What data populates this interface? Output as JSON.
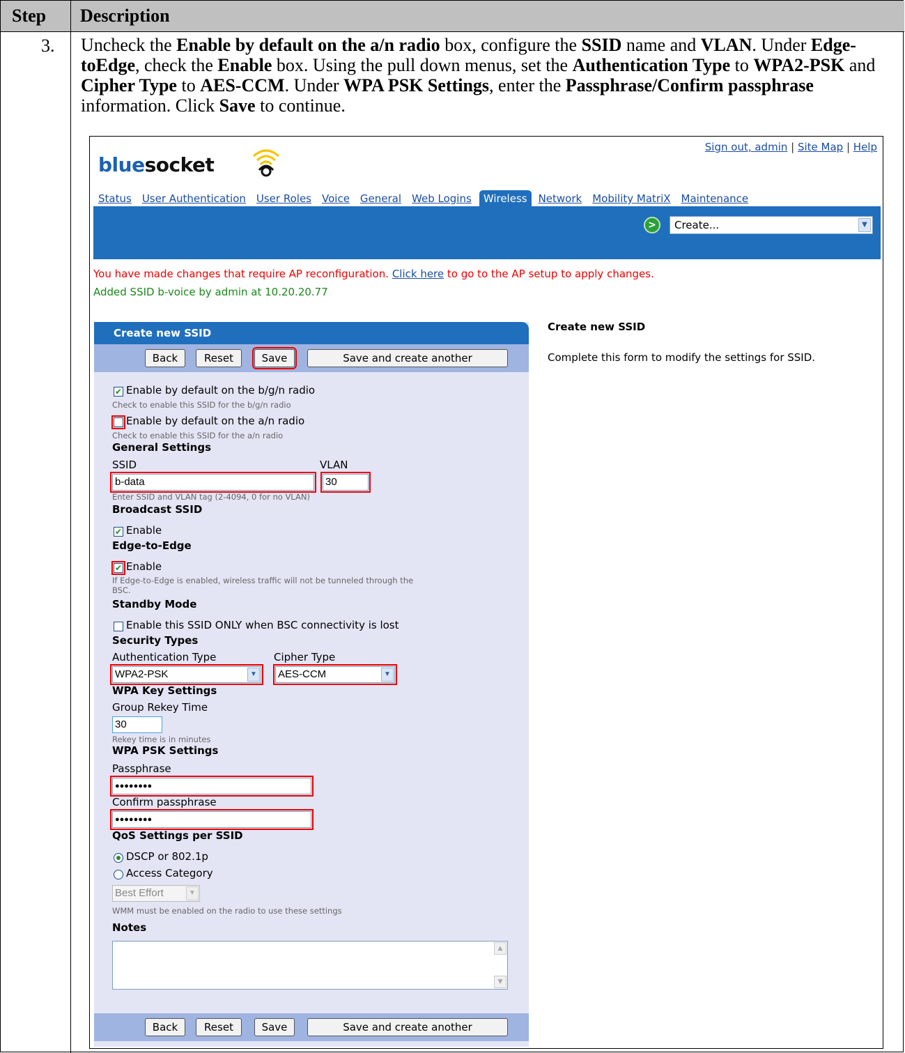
{
  "doc": {
    "col_step": "Step",
    "col_desc": "Description",
    "step_number": "3.",
    "instr": {
      "p1": "Uncheck the ",
      "b1": "Enable by default on the a/n radio",
      "p2": " box, configure the ",
      "b2": "SSID",
      "p3": " name and ",
      "b3": "VLAN",
      "p4": ". Under ",
      "b4": "Edge-toEdge",
      "p5": ", check the ",
      "b5": "Enable",
      "p6": " box. Using the pull down menus, set the ",
      "b6": "Authentication Type",
      "p7": " to ",
      "b7": "WPA2-PSK",
      "p8": " and ",
      "b8": "Cipher Type",
      "p9": " to ",
      "b9": "AES-CCM",
      "p10": ". Under ",
      "b10": "WPA PSK Settings",
      "p11": ", enter the ",
      "b11": "Passphrase/Confirm passphrase",
      "p12": " information.  Click ",
      "b12": "Save",
      "p13": " to continue."
    }
  },
  "app": {
    "toplinks": {
      "signout": "Sign out, admin",
      "sep1": " | ",
      "sitemap": "Site Map",
      "sep2": " | ",
      "help": "Help"
    },
    "logo": {
      "part1": "blue",
      "part2": "socket"
    },
    "nav": [
      "Status",
      "User Authentication",
      "User Roles",
      "Voice",
      "General",
      "Web Logins",
      "Wireless",
      "Network",
      "Mobility MatriX",
      "Maintenance"
    ],
    "create_icon": ">",
    "create_select": "Create...",
    "msg_red_1": "You have made changes that require AP reconfiguration. ",
    "msg_red_link": "Click here",
    "msg_red_2": " to go to the AP setup to apply changes.",
    "msg_green": "Added SSID b-voice by admin at 10.20.20.77"
  },
  "form": {
    "title": "Create new SSID",
    "buttons": {
      "back": "Back",
      "reset": "Reset",
      "save": "Save",
      "save_another": "Save and create another"
    },
    "bgn_label": "Enable by default on the b/g/n radio",
    "bgn_hint": "Check to enable this SSID for the b/g/n radio",
    "an_label": "Enable by default on the a/n radio",
    "an_hint": "Check to enable this SSID for the a/n radio",
    "general_settings": "General Settings",
    "ssid_label": "SSID",
    "vlan_label": "VLAN",
    "ssid_value": "b-data",
    "vlan_value": "30",
    "ssid_hint": "Enter SSID and VLAN tag (2-4094, 0 for no VLAN)",
    "broadcast_ssid": "Broadcast SSID",
    "broadcast_enable": "Enable",
    "edge_to_edge": "Edge-to-Edge",
    "edge_enable": "Enable",
    "edge_hint_1": "If Edge-to-Edge is enabled, wireless traffic will not be tunneled through the",
    "edge_hint_2": "BSC.",
    "standby_mode": "Standby Mode",
    "standby_label": "Enable this SSID ONLY when BSC connectivity is lost",
    "security_types": "Security Types",
    "auth_type_label": "Authentication Type",
    "cipher_type_label": "Cipher Type",
    "auth_type_value": "WPA2-PSK",
    "cipher_type_value": "AES-CCM",
    "wpa_key_settings": "WPA Key Settings",
    "group_rekey_label": "Group Rekey Time",
    "group_rekey_value": "30",
    "rekey_hint": "Rekey time is in minutes",
    "wpa_psk_settings": "WPA PSK Settings",
    "passphrase_label": "Passphrase",
    "passphrase_value": "●●●●●●●●",
    "confirm_label": "Confirm passphrase",
    "confirm_value": "●●●●●●●●",
    "qos_settings": "QoS Settings per SSID",
    "qos_dscp": "DSCP or 802.1p",
    "qos_access": "Access Category",
    "best_effort": "Best Effort",
    "wmm_hint": "WMM must be enabled on the radio to use these settings",
    "notes_label": "Notes"
  },
  "help": {
    "title": "Create new SSID",
    "text": "Complete this form to modify the settings for SSID."
  },
  "state": {
    "bgn_checked": true,
    "an_checked": false,
    "broadcast_checked": true,
    "edge_checked": true,
    "standby_checked": false,
    "qos_selected": "DSCP or 802.1p"
  },
  "colors": {
    "accent_blue": "#1f6fbd",
    "highlight_red": "#e00000",
    "panel_bg": "#e3e5f5"
  }
}
